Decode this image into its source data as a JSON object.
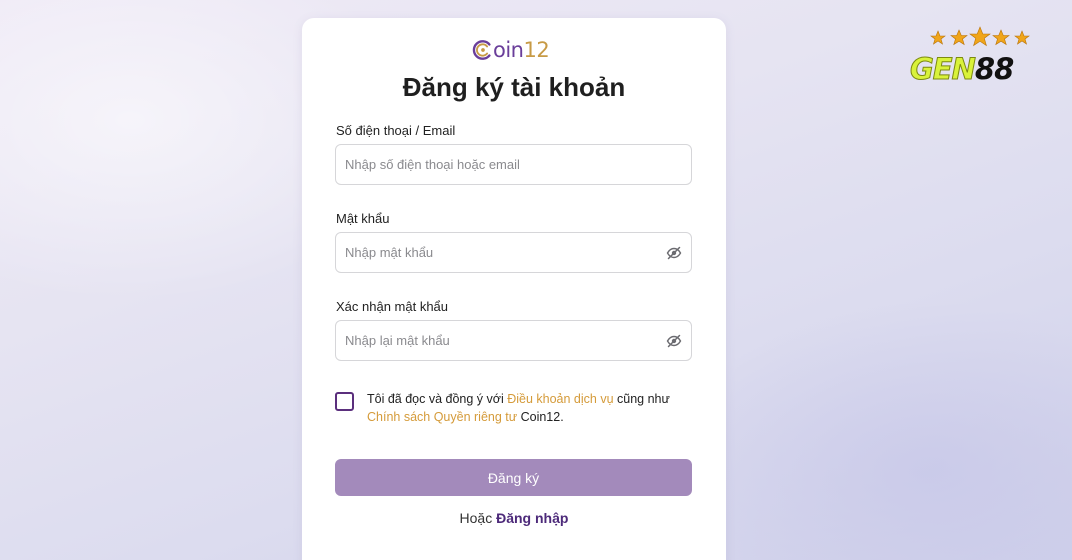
{
  "watermark": {
    "brand_part1": "GEN",
    "brand_part2": "88",
    "stars_icon": "five-stars",
    "colors": {
      "brand": "#d9f23a",
      "stars": "#f0a51a"
    }
  },
  "logo": {
    "icon": "coin-c-logo",
    "text_main": "oin",
    "text_num": "12",
    "colors": {
      "purple": "#6a3e9a",
      "gold": "#c79a45"
    }
  },
  "page_title": "Đăng ký tài khoản",
  "form": {
    "phone_email": {
      "label": "Số điện thoại / Email",
      "placeholder": "Nhập số điện thoại hoặc email",
      "value": ""
    },
    "password": {
      "label": "Mật khẩu",
      "placeholder": "Nhập mật khẩu",
      "value": "",
      "toggle_icon": "eye-slash-icon"
    },
    "confirm_password": {
      "label": "Xác nhận mật khẩu",
      "placeholder": "Nhập lại mật khẩu",
      "value": "",
      "toggle_icon": "eye-slash-icon"
    },
    "agreement": {
      "checked": false,
      "text_1": "Tôi đã đọc và đồng ý với ",
      "terms_link": "Điều khoản dịch vụ",
      "text_2": " cũng như ",
      "privacy_link": "Chính sách Quyền riêng tư",
      "text_3": " Coin12."
    },
    "submit_label": "Đăng ký",
    "alt_prefix": "Hoặc ",
    "login_link": "Đăng nhập"
  },
  "colors": {
    "accent": "#5b2f7d",
    "button": "#a38abb",
    "link": "#d59b3a"
  }
}
